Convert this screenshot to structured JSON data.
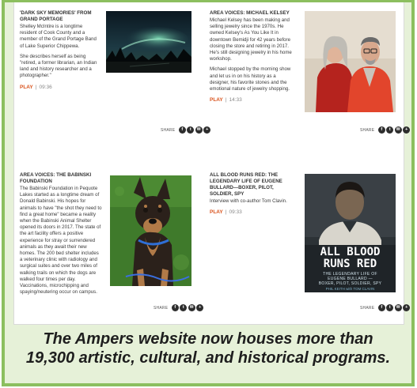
{
  "stories": [
    {
      "title": "'DARK SKY MEMORIES' FROM GRAND PORTAGE",
      "paragraphs": [
        "Shelley McIntire is a longtime resident of Cook County and a member of the Grand Portage Band of Lake Superior Chippewa.",
        "She describes herself as being \"retired, a former librarian, an Indian land and history researcher and a photographer.\""
      ],
      "play_label": "PLAY",
      "duration": "09:36",
      "share_label": "SHARE",
      "image_icon": "northern-lights-photo"
    },
    {
      "title": "AREA VOICES: MICHAEL KELSEY",
      "paragraphs": [
        "Michael Kelsey has been making and selling jewelry since the 1970s. He owned Kelsey's As You Like It in downtown Bemidji for 42 years before closing the store and retiring in 2017. He's still designing jewelry in his home workshop.",
        "Michael stopped by the morning show and let us in on his history as a designer, his favorite stones and the emotional nature of jewelry shopping."
      ],
      "play_label": "PLAY",
      "duration": "14:33",
      "share_label": "SHARE",
      "image_icon": "couple-portrait-photo"
    },
    {
      "title": "AREA VOICES: THE BABINSKI FOUNDATION",
      "paragraphs": [
        "The Babinski Foundation in Pequote Lakes started as a longtime dream of Donald Babinski. His hopes for animals to have \"the shot they need to find a great home\" became a reality when the Babinski Animal Shelter opened its doors in 2017. The state of the art facility offers a positive experience for stray or surrendered animals as they await their new homes. The 200 bed shelter includes a veterinary clinic with radiology and surgical suites and over two miles of walking trails on which the dogs are walked four times per day. Vaccinations, microchipping and spaying/neutering occur on campus."
      ],
      "play_label": "",
      "duration": "",
      "share_label": "SHARE",
      "image_icon": "dog-photo"
    },
    {
      "title": "ALL BLOOD RUNS RED: THE LEGENDARY LIFE OF EUGENE BULLARD—BOXER, PILOT, SOLDIER, SPY",
      "paragraphs": [
        "Interview with co-author Tom Clavin."
      ],
      "play_label": "PLAY",
      "duration": "09:33",
      "share_label": "SHARE",
      "image_icon": "book-cover-photo",
      "book": {
        "title_line1": "ALL BLOOD",
        "title_line2": "RUNS RED",
        "subtitle1": "THE LEGENDARY LIFE OF",
        "subtitle2": "EUGENE BULLARD —",
        "subtitle3": "BOXER, PILOT, SOLDIER, SPY",
        "authors": "PHIL KEITH with TOM CLAVIN"
      }
    }
  ],
  "share_icons": [
    "facebook-icon",
    "twitter-icon",
    "email-icon",
    "link-icon"
  ],
  "caption": {
    "line1": "The Ampers website now houses more than",
    "line2": "19,300 artistic, cultural, and historical programs."
  }
}
